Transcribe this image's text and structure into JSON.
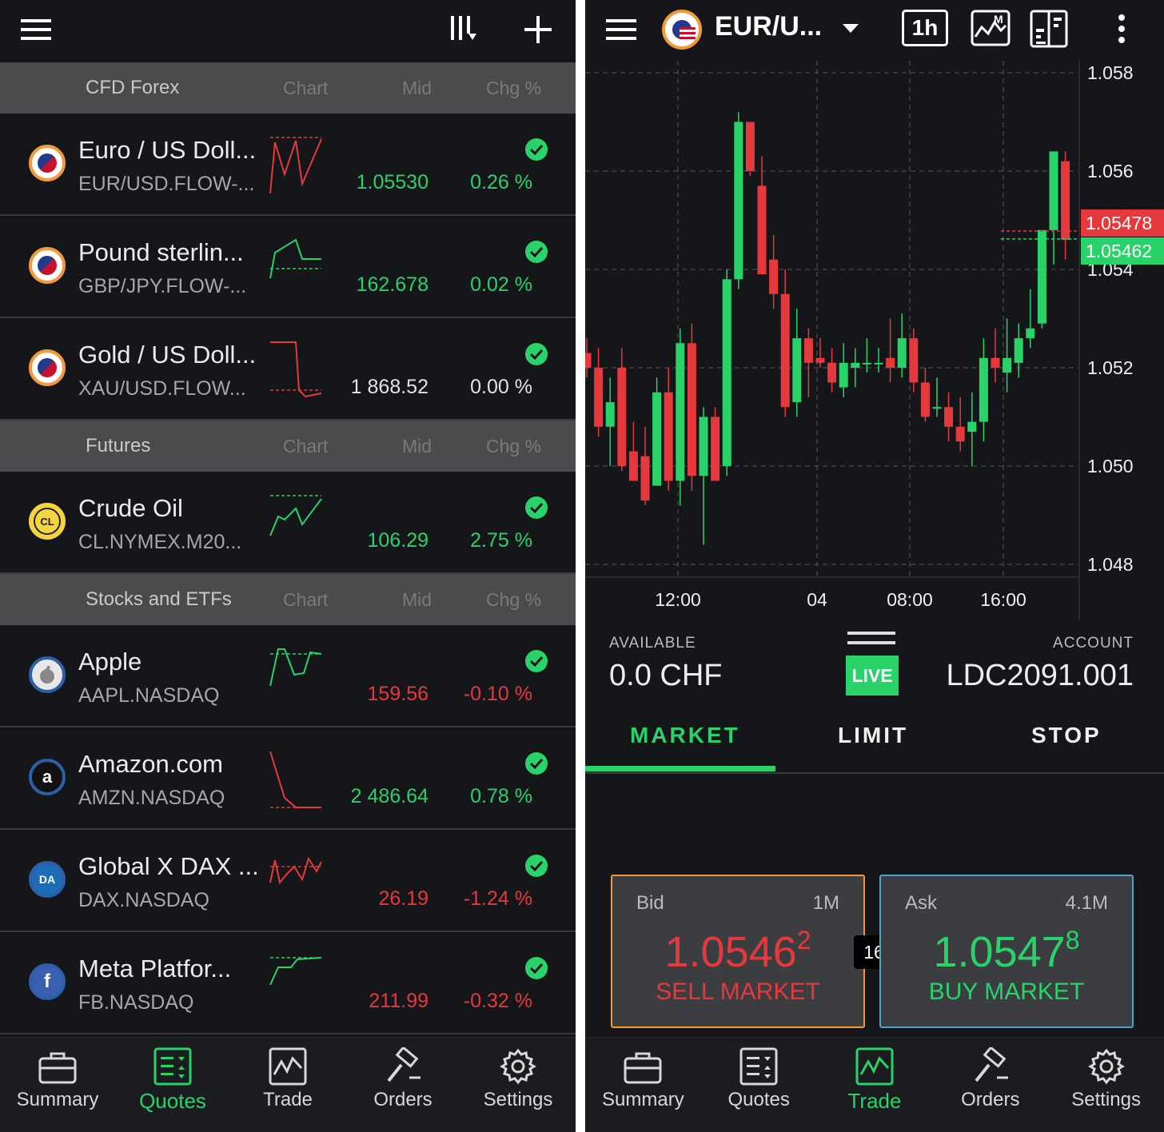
{
  "colors": {
    "up": "#2ad36a",
    "down": "#e5393d",
    "bg": "#151619",
    "section": "#4a4b4d"
  },
  "quotes": {
    "header_icons": [
      "menu-icon",
      "sort-columns-icon",
      "plus-icon"
    ],
    "col_chart": "Chart",
    "col_mid": "Mid",
    "col_chg": "Chg %",
    "sections": [
      {
        "name": "CFD Forex"
      },
      {
        "name": "Futures"
      },
      {
        "name": "Stocks and ETFs"
      }
    ],
    "rows": [
      {
        "title": "Euro / US Doll...",
        "symbol": "EUR/USD.FLOW-...",
        "mid": "1.05530",
        "chg": "0.26 %",
        "dir": "up",
        "avatar": "eu-us-flag"
      },
      {
        "title": "Pound sterlin...",
        "symbol": "GBP/JPY.FLOW-...",
        "mid": "162.678",
        "chg": "0.02 %",
        "dir": "up",
        "avatar": "uk-jp-flag"
      },
      {
        "title": "Gold / US Doll...",
        "symbol": "XAU/USD.FLOW...",
        "mid": "1 868.52",
        "chg": "0.00 %",
        "dir": "flat",
        "avatar": "gold-us-flag"
      },
      {
        "title": "Crude Oil",
        "symbol": "CL.NYMEX.M20...",
        "mid": "106.29",
        "chg": "2.75 %",
        "dir": "up",
        "avatar": "CL"
      },
      {
        "title": "Apple",
        "symbol": "AAPL.NASDAQ",
        "mid": "159.56",
        "chg": "-0.10 %",
        "dir": "down",
        "avatar": "apple-logo"
      },
      {
        "title": "Amazon.com",
        "symbol": "AMZN.NASDAQ",
        "mid": "2 486.64",
        "chg": "0.78 %",
        "dir": "up",
        "avatar": "a"
      },
      {
        "title": "Global X DAX ...",
        "symbol": "DAX.NASDAQ",
        "mid": "26.19",
        "chg": "-1.24 %",
        "dir": "down",
        "avatar": "DA"
      },
      {
        "title": "Meta Platfor...",
        "symbol": "FB.NASDAQ",
        "mid": "211.99",
        "chg": "-0.32 %",
        "dir": "down",
        "avatar": "f"
      }
    ]
  },
  "nav": {
    "items": [
      {
        "label": "Summary",
        "icon": "briefcase-icon"
      },
      {
        "label": "Quotes",
        "icon": "quotes-list-icon"
      },
      {
        "label": "Trade",
        "icon": "trade-chart-icon"
      },
      {
        "label": "Orders",
        "icon": "gavel-icon"
      },
      {
        "label": "Settings",
        "icon": "gear-icon"
      }
    ],
    "left_active": "Quotes",
    "right_active": "Trade"
  },
  "trade": {
    "instrument": "EUR/U...",
    "timeframe": "1h",
    "chart_data": {
      "type": "candlestick",
      "y_ticks": [
        "1.058",
        "1.056",
        "1.054",
        "1.052",
        "1.050",
        "1.048"
      ],
      "x_ticks": [
        "12:00",
        "04",
        "08:00",
        "16:00"
      ],
      "ylim": [
        1.047,
        1.0585
      ],
      "grid": true,
      "candles": [
        [
          1.0523,
          1.0526,
          1.0518,
          1.052
        ],
        [
          1.052,
          1.0524,
          1.0506,
          1.0508
        ],
        [
          1.0508,
          1.0518,
          1.05,
          1.0513
        ],
        [
          1.052,
          1.0524,
          1.0499,
          1.05
        ],
        [
          1.0503,
          1.0509,
          1.0497,
          1.0497
        ],
        [
          1.0502,
          1.0508,
          1.0492,
          1.0493
        ],
        [
          1.0496,
          1.0518,
          1.0496,
          1.0515
        ],
        [
          1.0515,
          1.052,
          1.0495,
          1.0497
        ],
        [
          1.0497,
          1.0528,
          1.0492,
          1.0525
        ],
        [
          1.0525,
          1.0529,
          1.0495,
          1.0498
        ],
        [
          1.0498,
          1.0512,
          1.0484,
          1.051
        ],
        [
          1.051,
          1.0512,
          1.0497,
          1.0497
        ],
        [
          1.05,
          1.054,
          1.0498,
          1.0538
        ],
        [
          1.0538,
          1.0572,
          1.0536,
          1.057
        ],
        [
          1.057,
          1.0565,
          1.0559,
          1.056
        ],
        [
          1.0557,
          1.0563,
          1.0539,
          1.0539
        ],
        [
          1.0542,
          1.0547,
          1.0532,
          1.0535
        ],
        [
          1.0535,
          1.054,
          1.051,
          1.0512
        ],
        [
          1.0513,
          1.0532,
          1.051,
          1.0526
        ],
        [
          1.0526,
          1.0528,
          1.0514,
          1.0521
        ],
        [
          1.0522,
          1.0526,
          1.052,
          1.0521
        ],
        [
          1.0521,
          1.0524,
          1.0515,
          1.0517
        ],
        [
          1.0516,
          1.0525,
          1.0514,
          1.0521
        ],
        [
          1.052,
          1.0524,
          1.0516,
          1.0521
        ],
        [
          1.0521,
          1.0526,
          1.0519,
          1.0521
        ],
        [
          1.0521,
          1.0524,
          1.0519,
          1.0521
        ],
        [
          1.0522,
          1.053,
          1.0517,
          1.052
        ],
        [
          1.052,
          1.0531,
          1.0518,
          1.0526
        ],
        [
          1.0526,
          1.0528,
          1.0515,
          1.0517
        ],
        [
          1.0517,
          1.052,
          1.0509,
          1.051
        ],
        [
          1.0512,
          1.0518,
          1.051,
          1.0512
        ],
        [
          1.0512,
          1.0515,
          1.0505,
          1.0508
        ],
        [
          1.0508,
          1.0514,
          1.0503,
          1.0505
        ],
        [
          1.0507,
          1.0515,
          1.05,
          1.0509
        ],
        [
          1.0509,
          1.0526,
          1.0505,
          1.0522
        ],
        [
          1.0522,
          1.0528,
          1.0517,
          1.052
        ],
        [
          1.0519,
          1.053,
          1.0515,
          1.0522
        ],
        [
          1.0521,
          1.0529,
          1.0518,
          1.0526
        ],
        [
          1.0526,
          1.0536,
          1.0524,
          1.0528
        ],
        [
          1.0529,
          1.0544,
          1.0528,
          1.0548
        ],
        [
          1.0548,
          1.0562,
          1.0541,
          1.0564
        ],
        [
          1.0562,
          1.0564,
          1.0542,
          1.0546
        ]
      ]
    },
    "price_tags": {
      "ask": "1.05478",
      "bid": "1.05462"
    },
    "available_label": "AVAILABLE",
    "available_value": "0.0 CHF",
    "live_badge": "LIVE",
    "account_label": "ACCOUNT",
    "account_value": "LDC2091.001",
    "tabs": [
      "MARKET",
      "LIMIT",
      "STOP"
    ],
    "bid": {
      "label": "Bid",
      "size": "1M",
      "price_main": "1.0546",
      "price_sup": "2",
      "action": "SELL MARKET"
    },
    "ask": {
      "label": "Ask",
      "size": "4.1M",
      "price_main": "1.0547",
      "price_sup": "8",
      "action": "BUY MARKET"
    },
    "spread": "16"
  }
}
